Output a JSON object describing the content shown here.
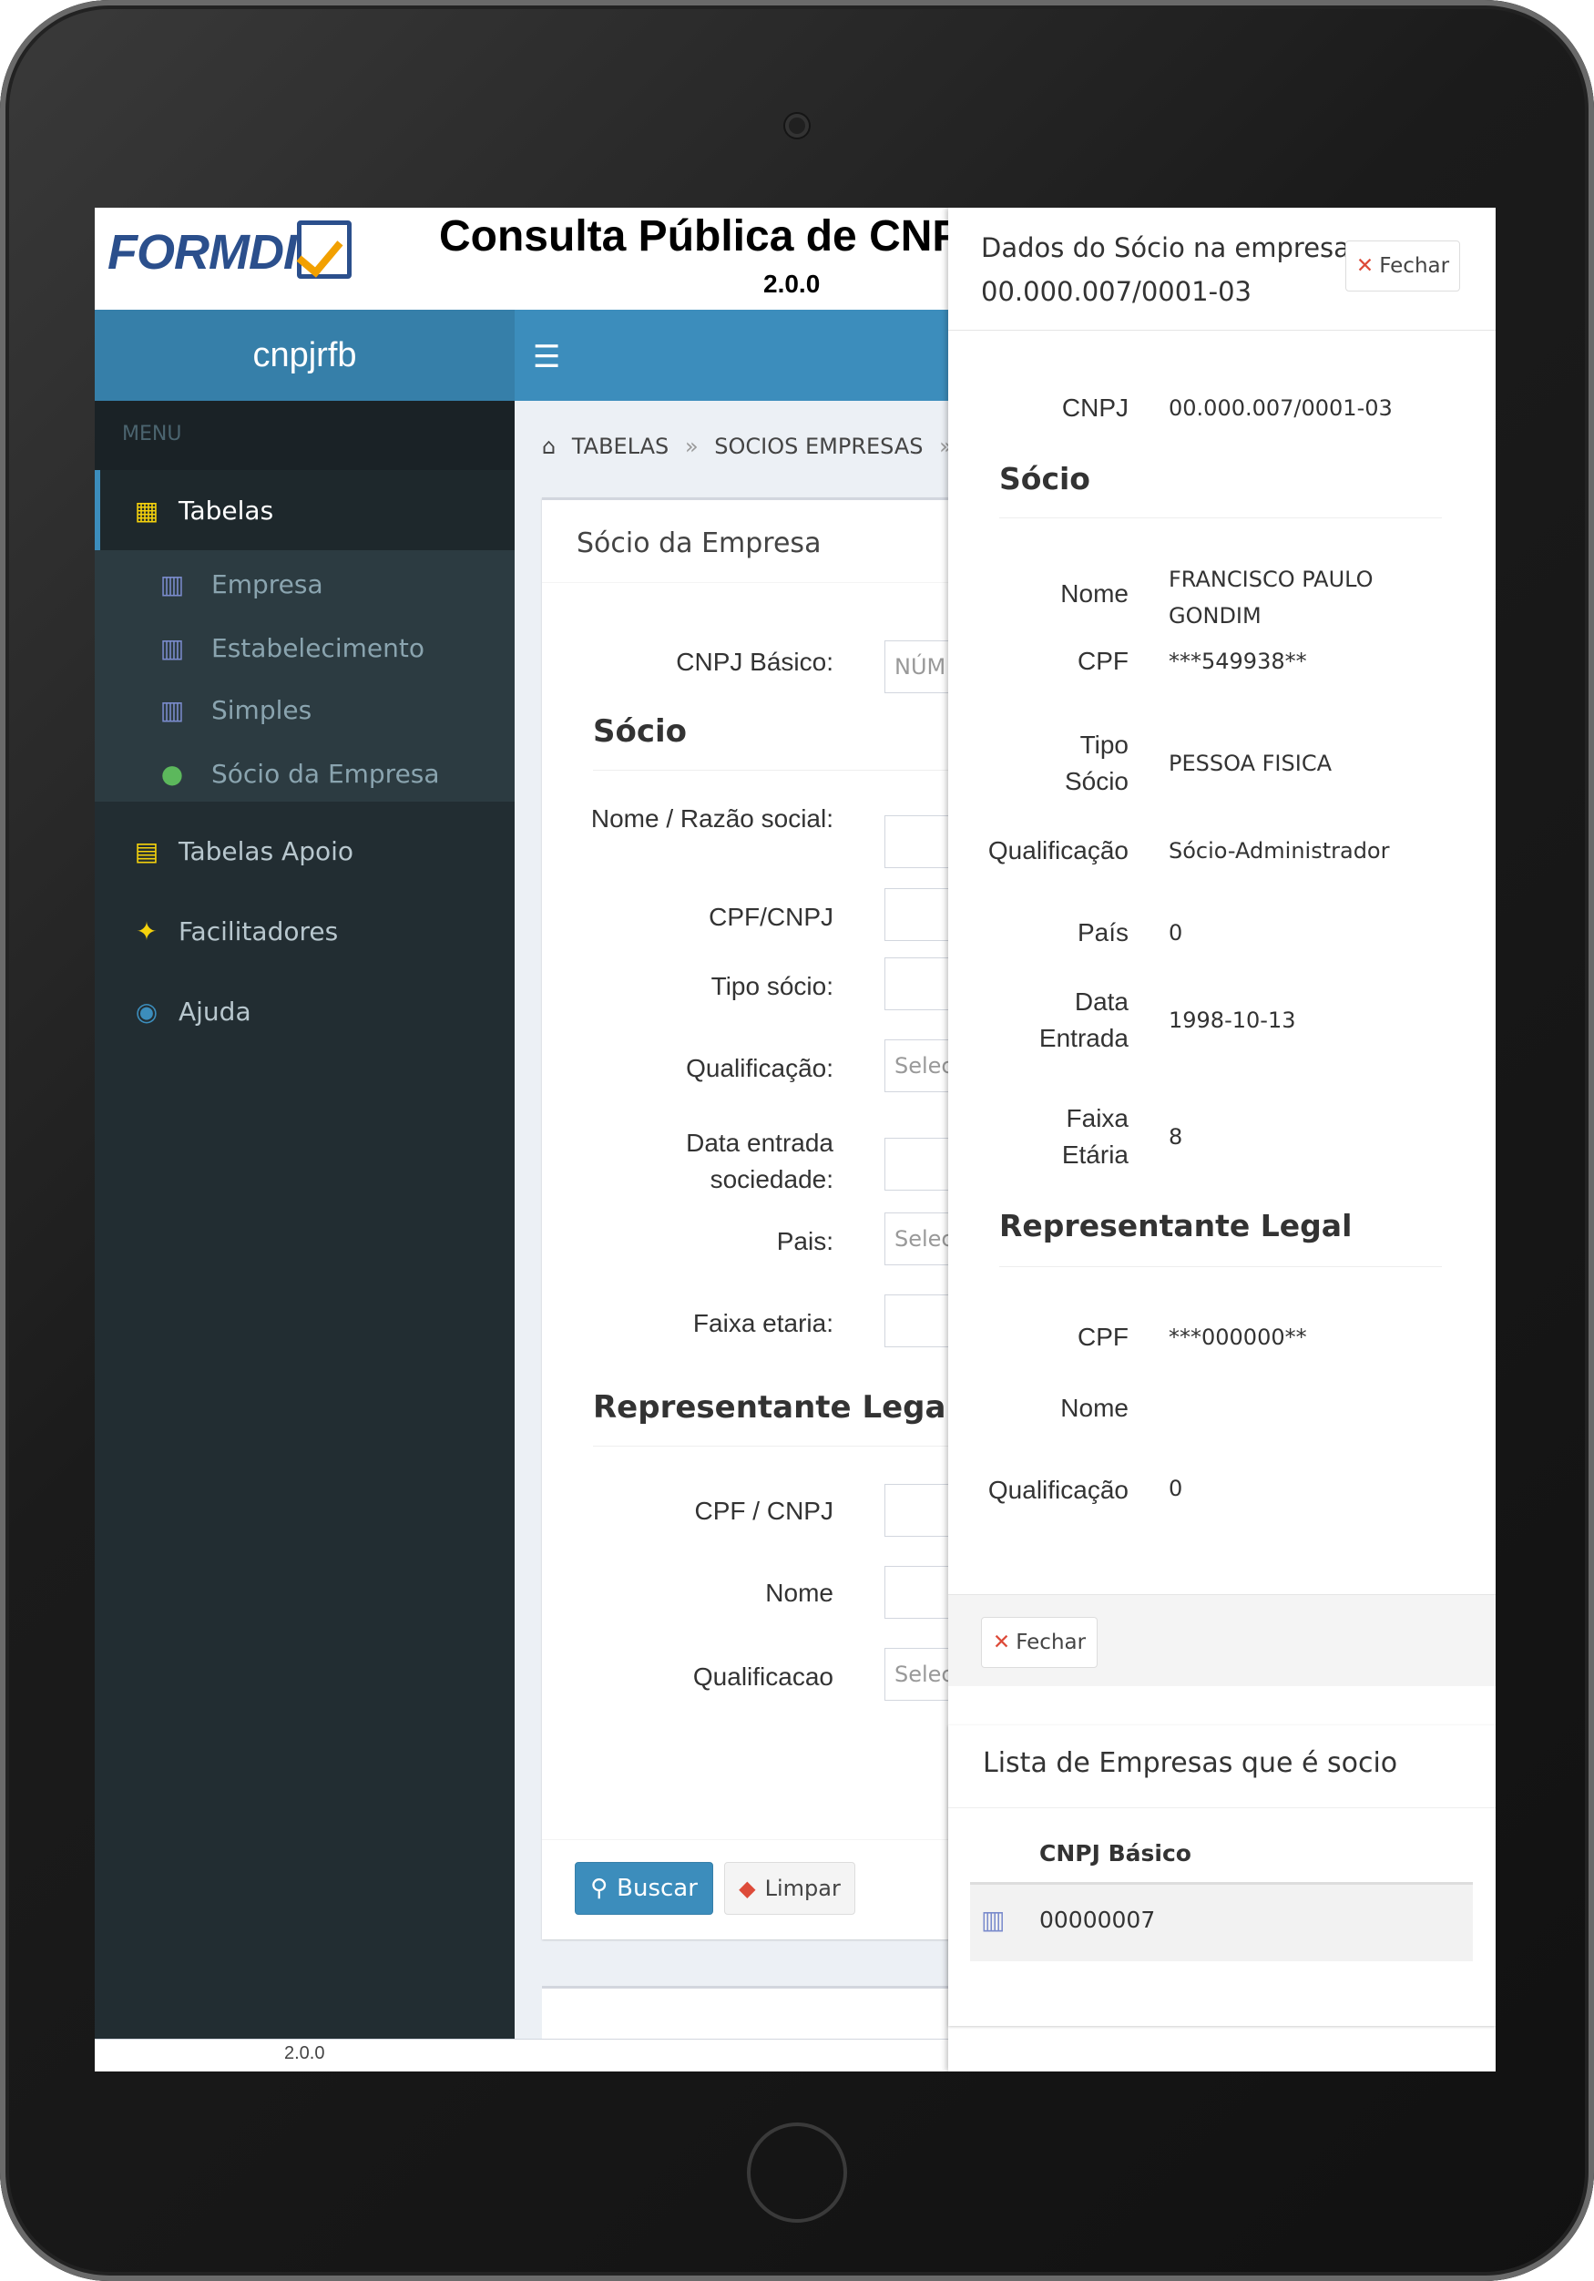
{
  "header": {
    "logo_text": "FORMDI",
    "title": "Consulta Pública de CNPJ",
    "version": "2.0.0"
  },
  "sidebar": {
    "brand": "cnpjrfb",
    "menu_header": "MENU",
    "items": [
      {
        "label": "Tabelas",
        "icon": "table-icon",
        "active": true
      },
      {
        "label": "Tabelas Apoio",
        "icon": "book-icon"
      },
      {
        "label": "Facilitadores",
        "icon": "magic-wand-icon"
      },
      {
        "label": "Ajuda",
        "icon": "life-ring-icon"
      }
    ],
    "subitems": [
      {
        "label": "Empresa",
        "icon": "building-icon"
      },
      {
        "label": "Estabelecimento",
        "icon": "building-icon"
      },
      {
        "label": "Simples",
        "icon": "building-icon"
      },
      {
        "label": "Sócio da Empresa",
        "icon": "user-icon"
      }
    ]
  },
  "breadcrumb": [
    "TABELAS",
    "SOCIOS EMPRESAS"
  ],
  "form": {
    "title": "Sócio da Empresa",
    "cnpj_basico_label": "CNPJ Básico:",
    "cnpj_basico_placeholder": "NÚM",
    "socio_section": "Sócio",
    "nome_label": "Nome / Razão social:",
    "cpf_label": "CPF/CNPJ",
    "tipo_label": "Tipo sócio:",
    "qualificacao_label": "Qualificação:",
    "qualificacao_placeholder": "Selec",
    "data_label": "Data entrada sociedade:",
    "pais_label": "Pais:",
    "pais_placeholder": "Selec",
    "faixa_label": "Faixa etaria:",
    "rep_section": "Representante Legal",
    "rep_cpf_label": "CPF / CNPJ",
    "rep_nome_label": "Nome",
    "rep_qual_label": "Qualificacao",
    "rep_qual_placeholder": "Selec",
    "buscar": "Buscar",
    "limpar": "Limpar"
  },
  "footer_version": "2.0.0",
  "panel": {
    "title_line1": "Dados do Sócio na empresa:",
    "title_line2": "00.000.007/0001-03",
    "close_label": "Fechar",
    "cnpj_label": "CNPJ",
    "cnpj_value": "00.000.007/0001-03",
    "socio_section": "Sócio",
    "nome_label": "Nome",
    "nome_value_1": "FRANCISCO PAULO",
    "nome_value_2": "GONDIM",
    "cpf_label": "CPF",
    "cpf_value": "***549938**",
    "tipo_label_1": "Tipo",
    "tipo_label_2": "Sócio",
    "tipo_value": "PESSOA FISICA",
    "qual_label": "Qualificação",
    "qual_value": "Sócio-Administrador",
    "pais_label": "País",
    "pais_value": "0",
    "data_label_1": "Data",
    "data_label_2": "Entrada",
    "data_value": "1998-10-13",
    "faixa_label_1": "Faixa",
    "faixa_label_2": "Etária",
    "faixa_value": "8",
    "rep_section": "Representante Legal",
    "rep_cpf_label": "CPF",
    "rep_cpf_value": "***000000**",
    "rep_nome_label": "Nome",
    "rep_qual_label": "Qualificação",
    "rep_qual_value": "0",
    "footer_close": "Fechar",
    "list_title": "Lista de Empresas que é socio",
    "table_header": "CNPJ Básico",
    "table_rows": [
      "00000007"
    ]
  },
  "colors": {
    "primary": "#3c8dbc",
    "brand": "#367fa9",
    "sidebar": "#222d32",
    "danger": "#dd4b39"
  }
}
